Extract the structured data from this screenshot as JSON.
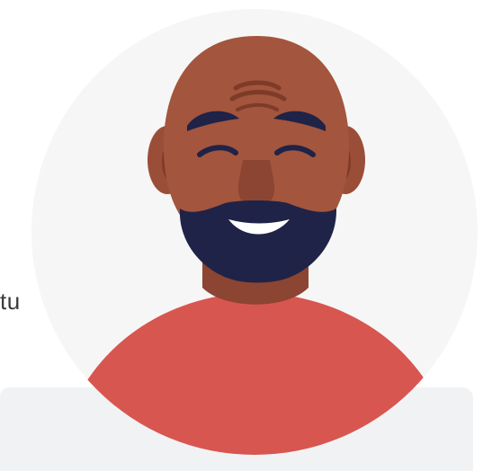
{
  "background_text": {
    "partial_label": "tu"
  },
  "avatar": {
    "icon": "bald-bearded-man-avatar-icon",
    "colors": {
      "circle_bg": "#f6f6f6",
      "skin": "#a3553d",
      "skin_shadow": "#8c4532",
      "beard": "#1f2347",
      "shirt": "#d85650",
      "teeth": "#ffffff"
    }
  },
  "card": {
    "color": "#f1f2f4"
  }
}
